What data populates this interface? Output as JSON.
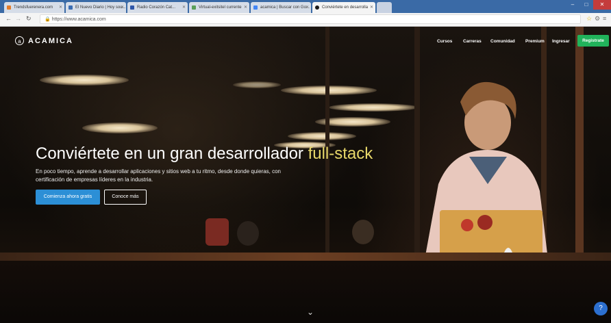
{
  "browser": {
    "tabs": [
      {
        "label": "Trendsfuerenera.com",
        "color": "#e47c2a"
      },
      {
        "label": "El Nuevo Diario | Hoy sou...",
        "color": "#3b6db3"
      },
      {
        "label": "Radio Corazón Cat...",
        "color": "#2f56a8"
      },
      {
        "label": "Virtual-exitsitel currente",
        "color": "#5aa05a"
      },
      {
        "label": "acamica | Buscar con Go...",
        "color": "#4285f4"
      },
      {
        "label": "Conviértete en desarrolla",
        "color": "#1a1a1a",
        "active": true
      }
    ],
    "url": "https://www.acamica.com",
    "back_icon": "arrow-left",
    "forward_icon": "arrow-right",
    "reload_icon": "reload"
  },
  "site": {
    "logo_text": "ACAMICA",
    "nav": [
      "Cursos",
      "Carreras",
      "Comunidad",
      "Premium",
      "Ingresar"
    ],
    "signup_label": "Registrate",
    "accent": "#21b35b"
  },
  "hero": {
    "headline_main": "Conviértete en un gran desarrollador ",
    "headline_highlight": "full-stack",
    "subtext": "En poco tiempo, aprende a desarrollar aplicaciones y sitios web a tu ritmo, desde donde quieras, con certificación de empresas líderes en la industria.",
    "cta_primary": "Comienza ahora gratis",
    "cta_secondary": "Conoce más",
    "highlight_color": "#e8d86a",
    "primary_color": "#2c8fd6"
  }
}
